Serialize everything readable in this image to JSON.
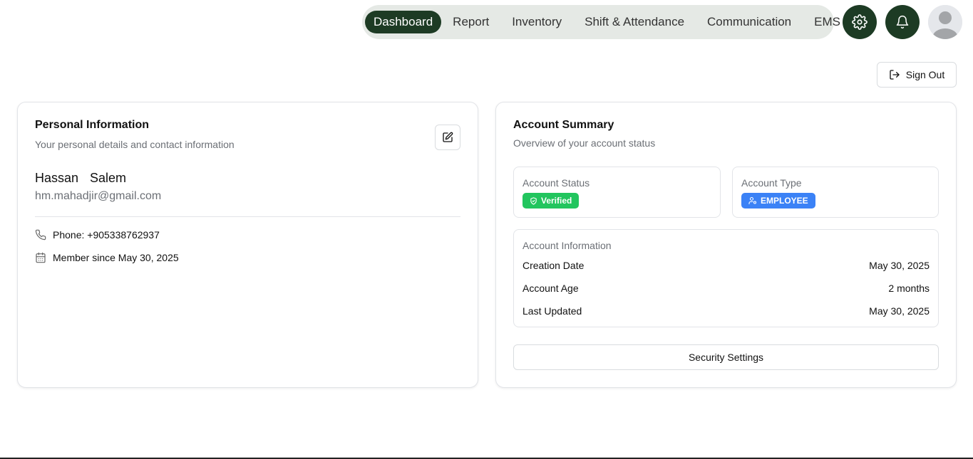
{
  "nav": {
    "items": [
      {
        "label": "Dashboard",
        "active": true
      },
      {
        "label": "Report",
        "active": false
      },
      {
        "label": "Inventory",
        "active": false
      },
      {
        "label": "Shift & Attendance",
        "active": false
      },
      {
        "label": "Communication",
        "active": false
      },
      {
        "label": "EMS",
        "active": false
      }
    ],
    "icons": {
      "settings": "gear-icon",
      "notifications": "bell-icon",
      "avatar": "user-avatar"
    }
  },
  "signout": {
    "label": "Sign Out",
    "icon": "log-out-icon"
  },
  "personal": {
    "title": "Personal Information",
    "subtitle": "Your personal details and contact information",
    "first_name": "Hassan",
    "last_name": "Salem",
    "email": "hm.mahadjir@gmail.com",
    "phone": "Phone: +905338762937",
    "member_since": "Member since May 30, 2025",
    "edit_icon": "edit-icon"
  },
  "summary": {
    "title": "Account Summary",
    "subtitle": "Overview of your account status",
    "status_label": "Account Status",
    "status_value": "Verified",
    "type_label": "Account Type",
    "type_value": "EMPLOYEE",
    "info_title": "Account Information",
    "rows": [
      {
        "label": "Creation Date",
        "value": "May 30, 2025"
      },
      {
        "label": "Account Age",
        "value": "2 months"
      },
      {
        "label": "Last Updated",
        "value": "May 30, 2025"
      }
    ],
    "security_button": "Security Settings"
  },
  "colors": {
    "brand_dark_green": "#1d3b24",
    "nav_pill_bg": "#e5e9e5",
    "verified_green": "#22c55e",
    "employee_blue": "#3b82f6"
  }
}
